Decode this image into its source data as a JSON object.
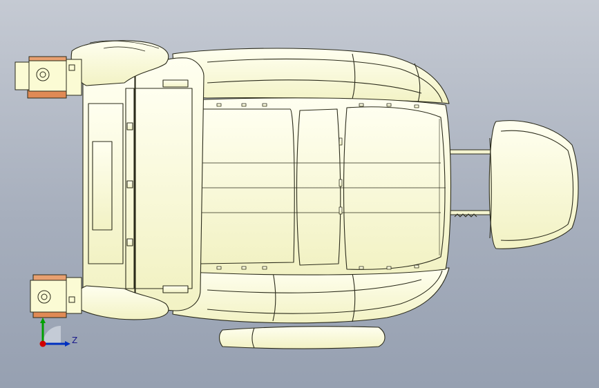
{
  "viewport": {
    "background_top": "#c5cad3",
    "background_bottom": "#96a0b1"
  },
  "model": {
    "fill_color": "#fbfbd4",
    "edge_color": "#2a2a1a",
    "metal_color": "#d9875a"
  },
  "triad": {
    "z_label": "Z",
    "x_color": "#d00000",
    "y_color": "#00a000",
    "z_color": "#0030c0"
  }
}
